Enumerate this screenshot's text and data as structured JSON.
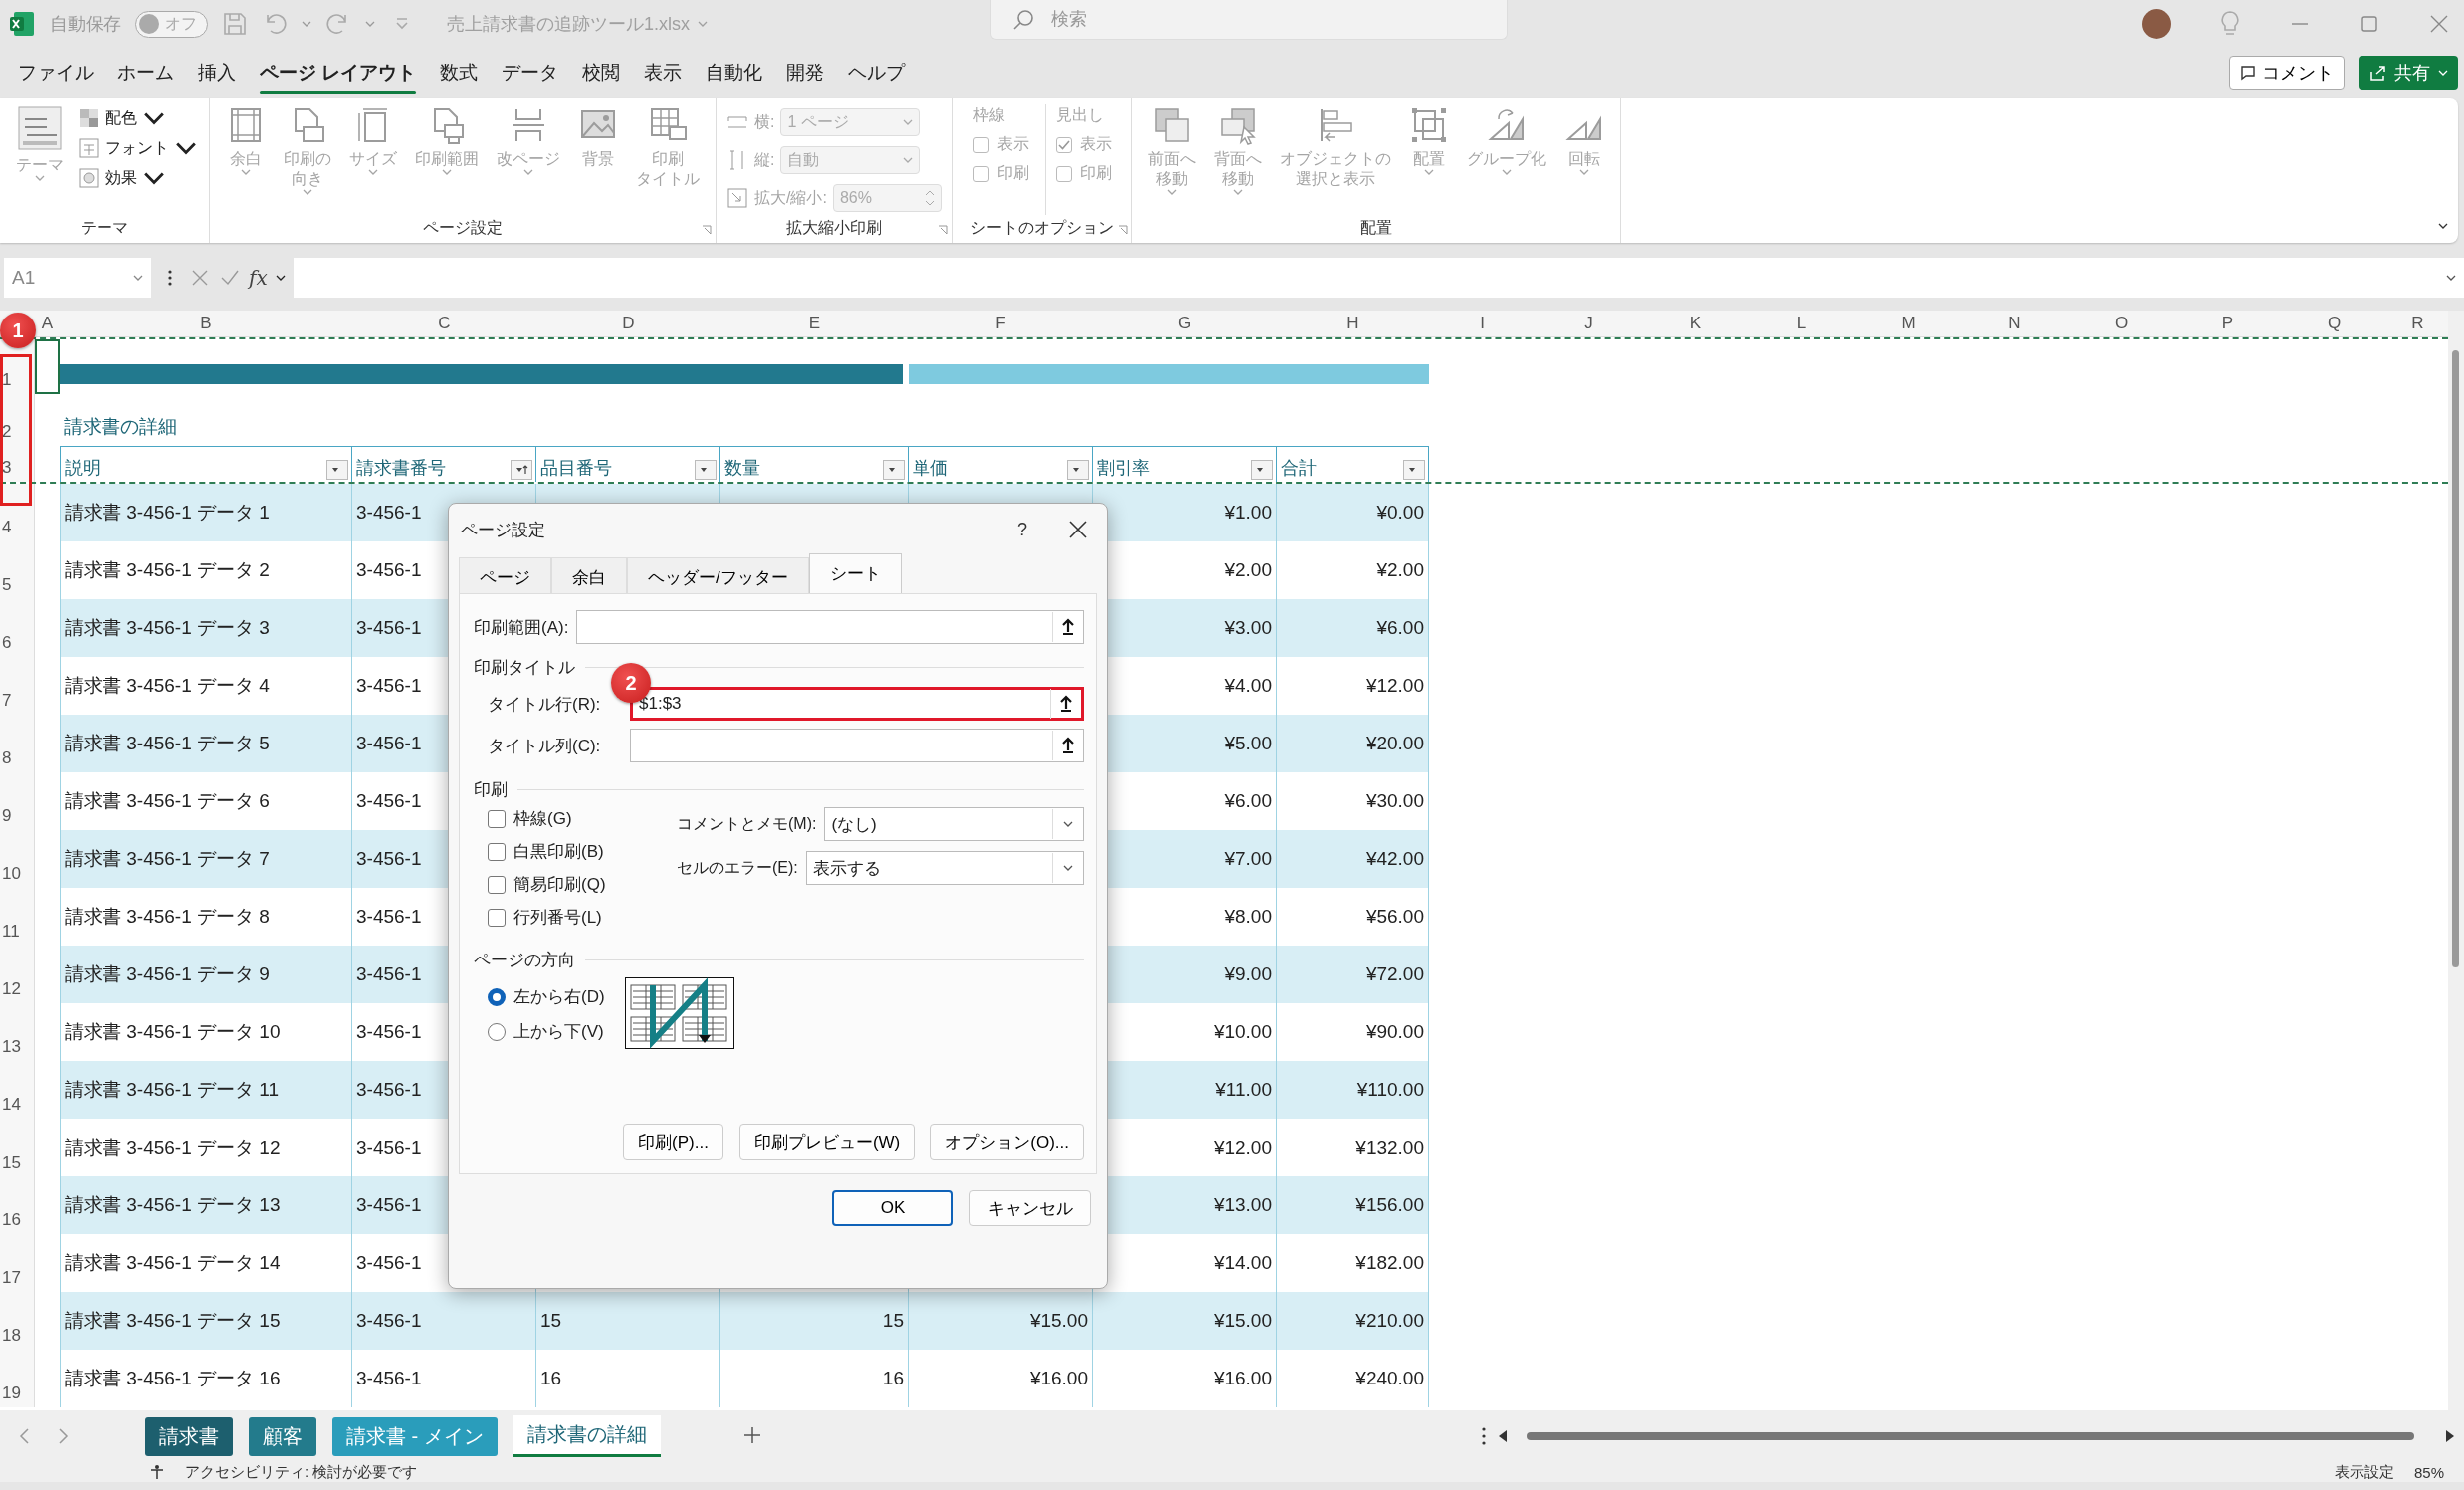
{
  "title_bar": {
    "autosave_label": "自動保存",
    "autosave": {
      "label": "オフ",
      "on": false
    },
    "file_name": "売上請求書の追跡ツール1.xlsx",
    "search": {
      "placeholder": "検索"
    }
  },
  "menu": {
    "tabs": [
      {
        "label": "ファイル",
        "selected": false
      },
      {
        "label": "ホーム",
        "selected": false
      },
      {
        "label": "挿入",
        "selected": false
      },
      {
        "label": "ページ レイアウト",
        "selected": true
      },
      {
        "label": "数式",
        "selected": false
      },
      {
        "label": "データ",
        "selected": false
      },
      {
        "label": "校閲",
        "selected": false
      },
      {
        "label": "表示",
        "selected": false
      },
      {
        "label": "自動化",
        "selected": false
      },
      {
        "label": "開発",
        "selected": false
      },
      {
        "label": "ヘルプ",
        "selected": false
      }
    ],
    "comment_button": "コメント",
    "share_button": "共有"
  },
  "ribbon": {
    "disabled": true,
    "groups": [
      {
        "kind": "theme",
        "label": "テーマ",
        "launcher": false,
        "big": "テーマ",
        "items": [
          "配色",
          "フォント",
          "効果"
        ]
      },
      {
        "kind": "buttons",
        "label": "ページ設定",
        "launcher": true,
        "buttons": [
          {
            "lines": [
              "余白"
            ],
            "dropdown": true
          },
          {
            "lines": [
              "印刷の",
              "向き"
            ],
            "dropdown": true
          },
          {
            "lines": [
              "サイズ"
            ],
            "dropdown": true
          },
          {
            "lines": [
              "印刷範囲"
            ],
            "dropdown": true
          },
          {
            "lines": [
              "改ページ"
            ],
            "dropdown": true
          },
          {
            "lines": [
              "背景"
            ],
            "dropdown": false
          },
          {
            "lines": [
              "印刷",
              "タイトル"
            ],
            "dropdown": false
          }
        ]
      },
      {
        "kind": "scale",
        "label": "拡大縮小印刷",
        "launcher": true,
        "fields": [
          {
            "label": "横:",
            "value": "1 ページ",
            "kind": "select"
          },
          {
            "label": "縦:",
            "value": "自動",
            "kind": "select"
          },
          {
            "label": "拡大/縮小:",
            "value": "86%",
            "kind": "spin"
          }
        ]
      },
      {
        "kind": "sheet_options",
        "label": "シートのオプション",
        "launcher": true,
        "columns": [
          {
            "title": "枠線",
            "items": [
              {
                "label": "表示",
                "checked": false
              },
              {
                "label": "印刷",
                "checked": false
              }
            ]
          },
          {
            "title": "見出し",
            "items": [
              {
                "label": "表示",
                "checked": true
              },
              {
                "label": "印刷",
                "checked": false
              }
            ]
          }
        ]
      },
      {
        "kind": "buttons",
        "label": "配置",
        "launcher": false,
        "buttons": [
          {
            "lines": [
              "前面へ",
              "移動"
            ],
            "dropdown": true
          },
          {
            "lines": [
              "背面へ",
              "移動"
            ],
            "dropdown": true
          },
          {
            "lines": [
              "オブジェクトの",
              "選択と表示"
            ],
            "dropdown": false
          },
          {
            "lines": [
              "配置"
            ],
            "dropdown": true
          },
          {
            "lines": [
              "グループ化"
            ],
            "dropdown": true
          },
          {
            "lines": [
              "回転"
            ],
            "dropdown": true
          }
        ]
      }
    ]
  },
  "formula_bar": {
    "name_box": "A1",
    "fx": "fx"
  },
  "sheet": {
    "columns": [
      "A",
      "B",
      "C",
      "D",
      "E",
      "F",
      "G",
      "H",
      "I",
      "J",
      "K",
      "L",
      "M",
      "N",
      "O",
      "P",
      "Q",
      "R"
    ],
    "title_row": {
      "row_number": "1"
    },
    "caption_row": {
      "row_number": "2",
      "text": "請求書の詳細"
    },
    "header_row": {
      "row_number": "3",
      "headers": [
        {
          "label": "説明",
          "sorted": false
        },
        {
          "label": "請求書番号",
          "sorted": true
        },
        {
          "label": "品目番号",
          "sorted": false
        },
        {
          "label": "数量",
          "sorted": false
        },
        {
          "label": "単価",
          "sorted": false
        },
        {
          "label": "割引率",
          "sorted": false
        },
        {
          "label": "合計",
          "sorted": false
        }
      ]
    },
    "annotation": {
      "badge": "1"
    },
    "rows": [
      {
        "row_number": "4",
        "description": "請求書 3-456-1 データ 1",
        "invoice_no": "3-456-1",
        "discount": "¥1.00",
        "total": "¥0.00"
      },
      {
        "row_number": "5",
        "description": "請求書 3-456-1 データ 2",
        "invoice_no": "3-456-1",
        "discount": "¥2.00",
        "total": "¥2.00"
      },
      {
        "row_number": "6",
        "description": "請求書 3-456-1 データ 3",
        "invoice_no": "3-456-1",
        "discount": "¥3.00",
        "total": "¥6.00"
      },
      {
        "row_number": "7",
        "description": "請求書 3-456-1 データ 4",
        "invoice_no": "3-456-1",
        "discount": "¥4.00",
        "total": "¥12.00"
      },
      {
        "row_number": "8",
        "description": "請求書 3-456-1 データ 5",
        "invoice_no": "3-456-1",
        "discount": "¥5.00",
        "total": "¥20.00"
      },
      {
        "row_number": "9",
        "description": "請求書 3-456-1 データ 6",
        "invoice_no": "3-456-1",
        "discount": "¥6.00",
        "total": "¥30.00"
      },
      {
        "row_number": "10",
        "description": "請求書 3-456-1 データ 7",
        "invoice_no": "3-456-1",
        "discount": "¥7.00",
        "total": "¥42.00"
      },
      {
        "row_number": "11",
        "description": "請求書 3-456-1 データ 8",
        "invoice_no": "3-456-1",
        "discount": "¥8.00",
        "total": "¥56.00"
      },
      {
        "row_number": "12",
        "description": "請求書 3-456-1 データ 9",
        "invoice_no": "3-456-1",
        "discount": "¥9.00",
        "total": "¥72.00"
      },
      {
        "row_number": "13",
        "description": "請求書 3-456-1 データ 10",
        "invoice_no": "3-456-1",
        "discount": "¥10.00",
        "total": "¥90.00"
      },
      {
        "row_number": "14",
        "description": "請求書 3-456-1 データ 11",
        "invoice_no": "3-456-1",
        "discount": "¥11.00",
        "total": "¥110.00"
      },
      {
        "row_number": "15",
        "description": "請求書 3-456-1 データ 12",
        "invoice_no": "3-456-1",
        "discount": "¥12.00",
        "total": "¥132.00"
      },
      {
        "row_number": "16",
        "description": "請求書 3-456-1 データ 13",
        "invoice_no": "3-456-1",
        "discount": "¥13.00",
        "total": "¥156.00"
      },
      {
        "row_number": "17",
        "description": "請求書 3-456-1 データ 14",
        "invoice_no": "3-456-1",
        "discount": "¥14.00",
        "total": "¥182.00"
      },
      {
        "row_number": "18",
        "description": "請求書 3-456-1 データ 15",
        "invoice_no": "3-456-1",
        "item_no": "15",
        "quantity": "15",
        "unit_price": "¥15.00",
        "discount": "¥15.00",
        "total": "¥210.00"
      },
      {
        "row_number": "19",
        "description": "請求書 3-456-1 データ 16",
        "invoice_no": "3-456-1",
        "item_no": "16",
        "quantity": "16",
        "unit_price": "¥16.00",
        "discount": "¥16.00",
        "total": "¥240.00"
      }
    ]
  },
  "sheet_tabs": [
    {
      "label": "請求書",
      "color": "#1d5f6e",
      "selected": false
    },
    {
      "label": "顧客",
      "color": "#237b8c",
      "selected": false
    },
    {
      "label": "請求書 - メイン",
      "color": "#2a9dbb",
      "selected": false
    },
    {
      "label": "請求書の詳細",
      "color": "#1d5f6e",
      "selected": true
    }
  ],
  "status_bar": {
    "accessibility": "アクセシビリティ: 検討が必要です",
    "display_settings": "表示設定",
    "zoom": "85%"
  },
  "dialog": {
    "title": "ページ設定",
    "help": "?",
    "tabs": [
      {
        "label": "ページ",
        "selected": false
      },
      {
        "label": "余白",
        "selected": false
      },
      {
        "label": "ヘッダー/フッター",
        "selected": false
      },
      {
        "label": "シート",
        "selected": true
      }
    ],
    "print_area": {
      "label": "印刷範囲(A):"
    },
    "print_titles": {
      "heading": "印刷タイトル",
      "fields": [
        {
          "label": "タイトル行(R):",
          "value": "$1:$3",
          "highlighted": true,
          "badge": "2"
        },
        {
          "label": "タイトル列(C):",
          "highlighted": false
        }
      ]
    },
    "print": {
      "heading": "印刷",
      "checkboxes": [
        {
          "label": "枠線(G)",
          "checked": false
        },
        {
          "label": "白黒印刷(B)",
          "checked": false
        },
        {
          "label": "簡易印刷(Q)",
          "checked": false
        },
        {
          "label": "行列番号(L)",
          "checked": false
        }
      ],
      "selects": [
        {
          "label": "コメントとメモ(M):",
          "value": "(なし)"
        },
        {
          "label": "セルのエラー(E):",
          "value": "表示する"
        }
      ]
    },
    "page_order": {
      "heading": "ページの方向",
      "options": [
        {
          "label": "左から右(D)",
          "selected": true
        },
        {
          "label": "上から下(V)",
          "selected": false
        }
      ]
    },
    "buttons": [
      "印刷(P)...",
      "印刷プレビュー(W)",
      "オプション(O)..."
    ],
    "ok": "OK",
    "cancel": "キャンセル"
  }
}
